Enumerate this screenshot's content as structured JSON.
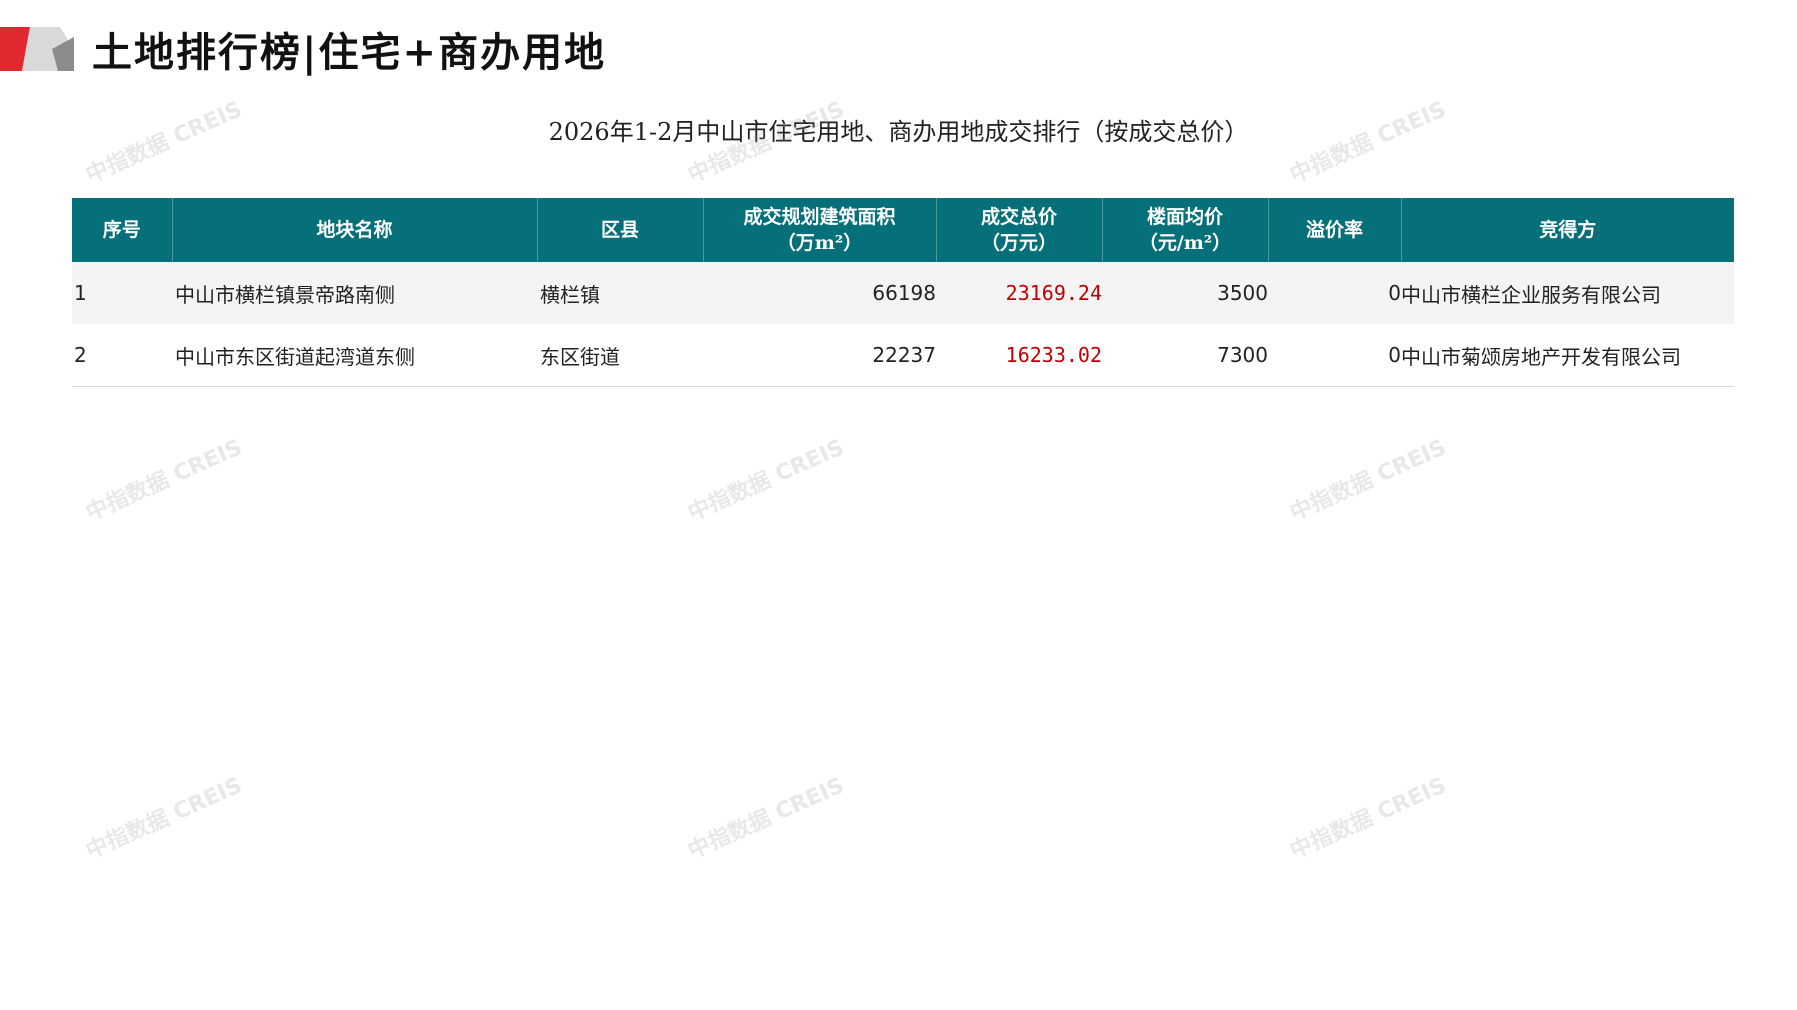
{
  "header": {
    "title": "土地排行榜|住宅+商办用地",
    "subtitle": "2026年1-2月中山市住宅用地、商办用地成交排行（按成交总价）"
  },
  "brand_colors": {
    "logo_red": "#e0282e",
    "logo_gray": "#bfbfbf",
    "header_teal": "#06707a",
    "price_red": "#c00000"
  },
  "table": {
    "columns": [
      {
        "line1": "序号",
        "line2": ""
      },
      {
        "line1": "地块名称",
        "line2": ""
      },
      {
        "line1": "区县",
        "line2": ""
      },
      {
        "line1": "成交规划建筑面积",
        "line2": "（万m²）"
      },
      {
        "line1": "成交总价",
        "line2": "（万元）"
      },
      {
        "line1": "楼面均价",
        "line2": "（元/m²）"
      },
      {
        "line1": "溢价率",
        "line2": ""
      },
      {
        "line1": "竞得方",
        "line2": ""
      }
    ],
    "rows": [
      {
        "idx": "1",
        "name": "中山市横栏镇景帝路南侧",
        "county": "横栏镇",
        "area": "66198",
        "price": "23169.24",
        "unit_price": "3500",
        "premium": "0",
        "winner": "中山市横栏企业服务有限公司"
      },
      {
        "idx": "2",
        "name": "中山市东区街道起湾道东侧",
        "county": "东区街道",
        "area": "22237",
        "price": "16233.02",
        "unit_price": "7300",
        "premium": "0",
        "winner": "中山市菊颂房地产开发有限公司"
      }
    ]
  },
  "watermark": {
    "text": "中指数据 CREIS"
  }
}
